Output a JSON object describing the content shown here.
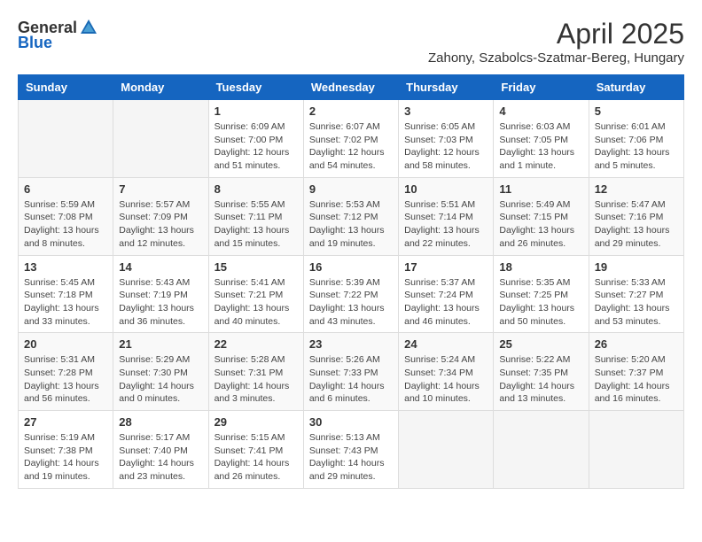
{
  "header": {
    "logo_general": "General",
    "logo_blue": "Blue",
    "title": "April 2025",
    "subtitle": "Zahony, Szabolcs-Szatmar-Bereg, Hungary"
  },
  "calendar": {
    "days_of_week": [
      "Sunday",
      "Monday",
      "Tuesday",
      "Wednesday",
      "Thursday",
      "Friday",
      "Saturday"
    ],
    "weeks": [
      [
        {
          "day": "",
          "info": ""
        },
        {
          "day": "",
          "info": ""
        },
        {
          "day": "1",
          "info": "Sunrise: 6:09 AM\nSunset: 7:00 PM\nDaylight: 12 hours and 51 minutes."
        },
        {
          "day": "2",
          "info": "Sunrise: 6:07 AM\nSunset: 7:02 PM\nDaylight: 12 hours and 54 minutes."
        },
        {
          "day": "3",
          "info": "Sunrise: 6:05 AM\nSunset: 7:03 PM\nDaylight: 12 hours and 58 minutes."
        },
        {
          "day": "4",
          "info": "Sunrise: 6:03 AM\nSunset: 7:05 PM\nDaylight: 13 hours and 1 minute."
        },
        {
          "day": "5",
          "info": "Sunrise: 6:01 AM\nSunset: 7:06 PM\nDaylight: 13 hours and 5 minutes."
        }
      ],
      [
        {
          "day": "6",
          "info": "Sunrise: 5:59 AM\nSunset: 7:08 PM\nDaylight: 13 hours and 8 minutes."
        },
        {
          "day": "7",
          "info": "Sunrise: 5:57 AM\nSunset: 7:09 PM\nDaylight: 13 hours and 12 minutes."
        },
        {
          "day": "8",
          "info": "Sunrise: 5:55 AM\nSunset: 7:11 PM\nDaylight: 13 hours and 15 minutes."
        },
        {
          "day": "9",
          "info": "Sunrise: 5:53 AM\nSunset: 7:12 PM\nDaylight: 13 hours and 19 minutes."
        },
        {
          "day": "10",
          "info": "Sunrise: 5:51 AM\nSunset: 7:14 PM\nDaylight: 13 hours and 22 minutes."
        },
        {
          "day": "11",
          "info": "Sunrise: 5:49 AM\nSunset: 7:15 PM\nDaylight: 13 hours and 26 minutes."
        },
        {
          "day": "12",
          "info": "Sunrise: 5:47 AM\nSunset: 7:16 PM\nDaylight: 13 hours and 29 minutes."
        }
      ],
      [
        {
          "day": "13",
          "info": "Sunrise: 5:45 AM\nSunset: 7:18 PM\nDaylight: 13 hours and 33 minutes."
        },
        {
          "day": "14",
          "info": "Sunrise: 5:43 AM\nSunset: 7:19 PM\nDaylight: 13 hours and 36 minutes."
        },
        {
          "day": "15",
          "info": "Sunrise: 5:41 AM\nSunset: 7:21 PM\nDaylight: 13 hours and 40 minutes."
        },
        {
          "day": "16",
          "info": "Sunrise: 5:39 AM\nSunset: 7:22 PM\nDaylight: 13 hours and 43 minutes."
        },
        {
          "day": "17",
          "info": "Sunrise: 5:37 AM\nSunset: 7:24 PM\nDaylight: 13 hours and 46 minutes."
        },
        {
          "day": "18",
          "info": "Sunrise: 5:35 AM\nSunset: 7:25 PM\nDaylight: 13 hours and 50 minutes."
        },
        {
          "day": "19",
          "info": "Sunrise: 5:33 AM\nSunset: 7:27 PM\nDaylight: 13 hours and 53 minutes."
        }
      ],
      [
        {
          "day": "20",
          "info": "Sunrise: 5:31 AM\nSunset: 7:28 PM\nDaylight: 13 hours and 56 minutes."
        },
        {
          "day": "21",
          "info": "Sunrise: 5:29 AM\nSunset: 7:30 PM\nDaylight: 14 hours and 0 minutes."
        },
        {
          "day": "22",
          "info": "Sunrise: 5:28 AM\nSunset: 7:31 PM\nDaylight: 14 hours and 3 minutes."
        },
        {
          "day": "23",
          "info": "Sunrise: 5:26 AM\nSunset: 7:33 PM\nDaylight: 14 hours and 6 minutes."
        },
        {
          "day": "24",
          "info": "Sunrise: 5:24 AM\nSunset: 7:34 PM\nDaylight: 14 hours and 10 minutes."
        },
        {
          "day": "25",
          "info": "Sunrise: 5:22 AM\nSunset: 7:35 PM\nDaylight: 14 hours and 13 minutes."
        },
        {
          "day": "26",
          "info": "Sunrise: 5:20 AM\nSunset: 7:37 PM\nDaylight: 14 hours and 16 minutes."
        }
      ],
      [
        {
          "day": "27",
          "info": "Sunrise: 5:19 AM\nSunset: 7:38 PM\nDaylight: 14 hours and 19 minutes."
        },
        {
          "day": "28",
          "info": "Sunrise: 5:17 AM\nSunset: 7:40 PM\nDaylight: 14 hours and 23 minutes."
        },
        {
          "day": "29",
          "info": "Sunrise: 5:15 AM\nSunset: 7:41 PM\nDaylight: 14 hours and 26 minutes."
        },
        {
          "day": "30",
          "info": "Sunrise: 5:13 AM\nSunset: 7:43 PM\nDaylight: 14 hours and 29 minutes."
        },
        {
          "day": "",
          "info": ""
        },
        {
          "day": "",
          "info": ""
        },
        {
          "day": "",
          "info": ""
        }
      ]
    ]
  }
}
